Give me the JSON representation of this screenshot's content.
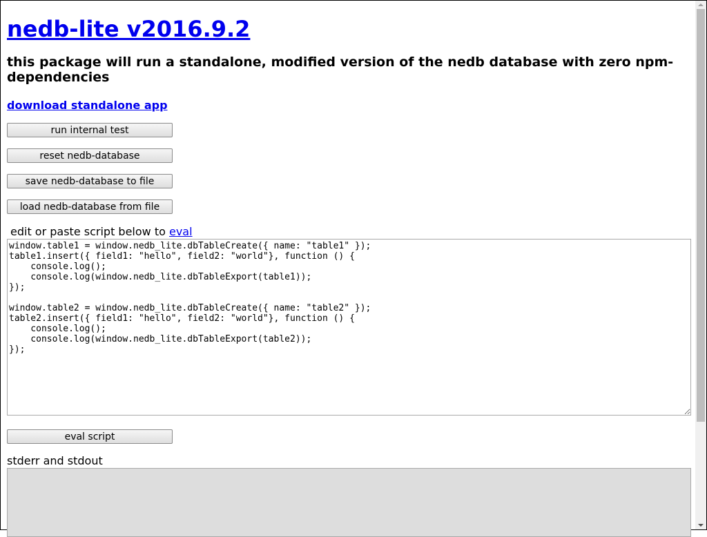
{
  "title": "nedb-lite v2016.9.2",
  "description": "this package will run a standalone, modified version of the nedb database with zero npm-dependencies",
  "download_link": "download standalone app",
  "buttons": {
    "run_test": "run internal test",
    "reset": "reset nedb-database",
    "save": "save nedb-database to file",
    "load": "load nedb-database from file",
    "eval": "eval script"
  },
  "editor": {
    "label": "edit or paste script below to ",
    "label_link": "eval",
    "script": "window.table1 = window.nedb_lite.dbTableCreate({ name: \"table1\" });\ntable1.insert({ field1: \"hello\", field2: \"world\"}, function () {\n    console.log();\n    console.log(window.nedb_lite.dbTableExport(table1));\n});\n\nwindow.table2 = window.nedb_lite.dbTableCreate({ name: \"table2\" });\ntable2.insert({ field1: \"hello\", field2: \"world\"}, function () {\n    console.log();\n    console.log(window.nedb_lite.dbTableExport(table2));\n});"
  },
  "output": {
    "label": "stderr and stdout",
    "value": ""
  }
}
